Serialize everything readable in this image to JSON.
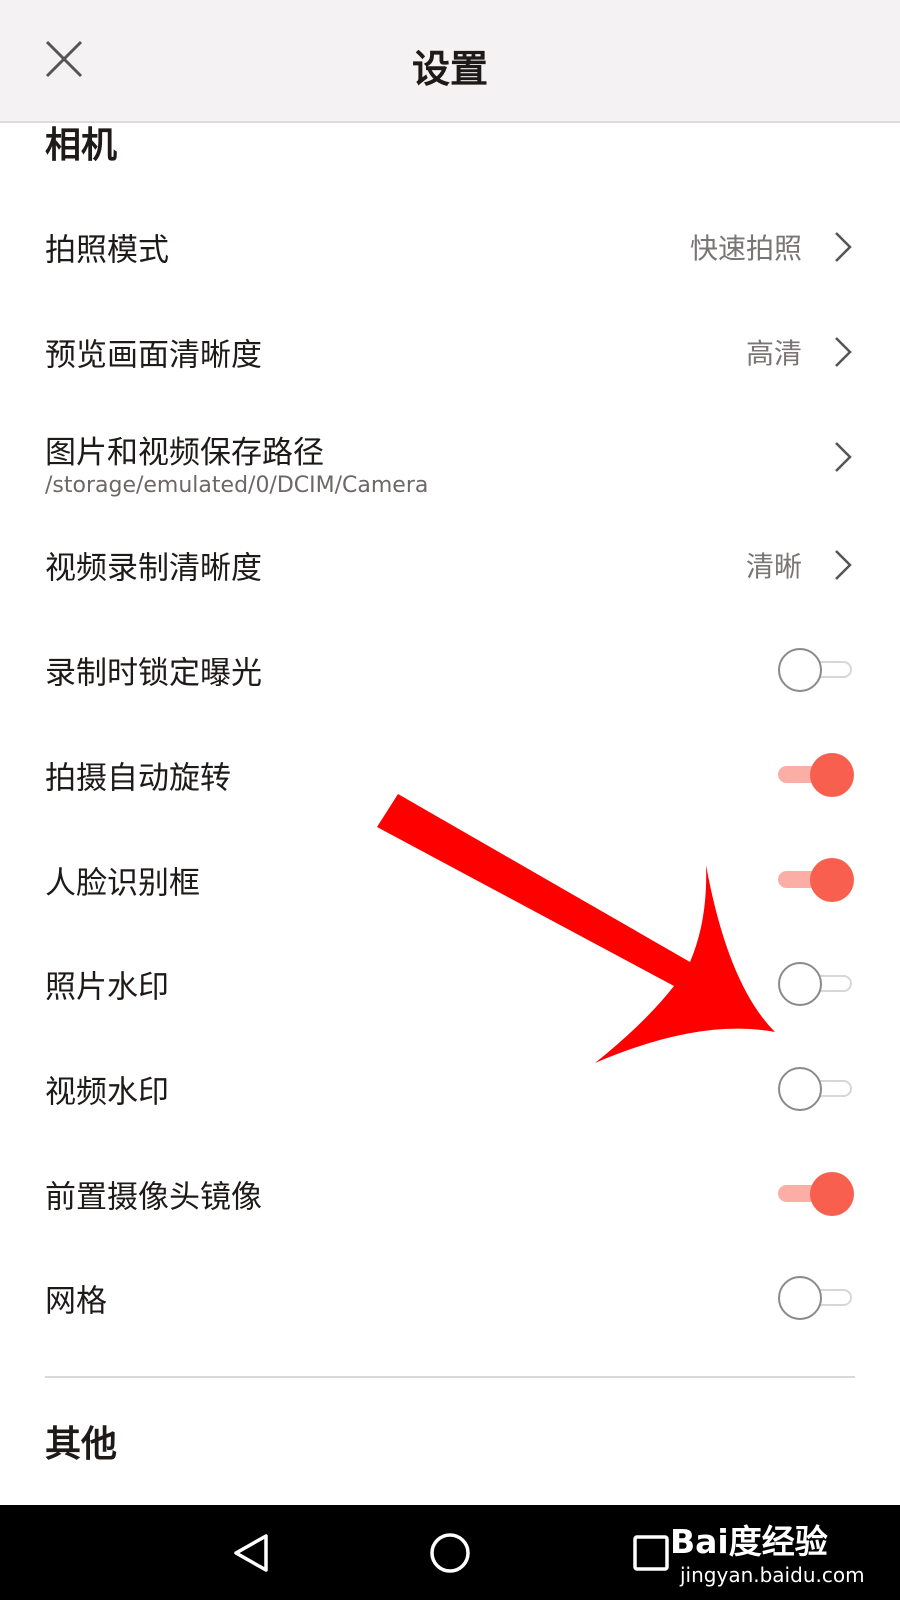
{
  "header": {
    "title": "设置"
  },
  "sections": {
    "camera": "相机",
    "other": "其他"
  },
  "rows": [
    {
      "label": "拍照模式",
      "value": "快速拍照"
    },
    {
      "label": "预览画面清晰度",
      "value": "高清"
    },
    {
      "label": "图片和视频保存路径",
      "sublabel": "/storage/emulated/0/DCIM/Camera"
    },
    {
      "label": "视频录制清晰度",
      "value": "清晰"
    },
    {
      "label": "录制时锁定曝光",
      "toggle": false
    },
    {
      "label": "拍摄自动旋转",
      "toggle": true
    },
    {
      "label": "人脸识别框",
      "toggle": true
    },
    {
      "label": "照片水印",
      "toggle": false
    },
    {
      "label": "视频水印",
      "toggle": false
    },
    {
      "label": "前置摄像头镜像",
      "toggle": true
    },
    {
      "label": "网格",
      "toggle": false
    }
  ],
  "watermark": {
    "brand": "Bai度经验",
    "url": "jingyan.baidu.com"
  },
  "colors": {
    "accent": "#f85f4e",
    "accent_track": "#fbaea5",
    "arrow": "#ff0000"
  },
  "icons": {
    "close": "close-icon",
    "chevron": "chevron-right-icon",
    "back": "back-triangle-icon",
    "home": "home-circle-icon",
    "recents": "recents-square-icon"
  }
}
